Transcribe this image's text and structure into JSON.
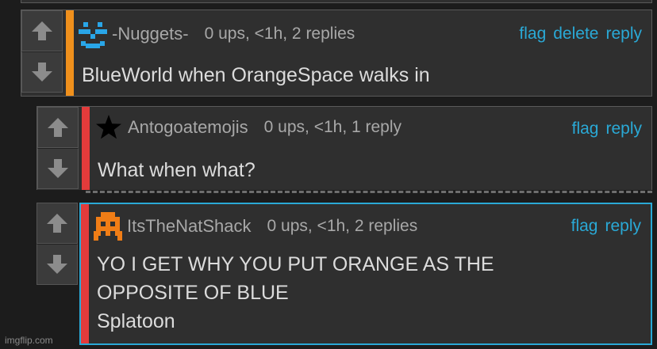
{
  "comments": [
    {
      "username": "-Nuggets-",
      "stats": "0 ups, <1h, 2 replies",
      "actions": [
        "flag",
        "delete",
        "reply"
      ],
      "body": "BlueWorld when OrangeSpace walks in",
      "accent_color": "#f0901c",
      "avatar_icon": "blue-pixel-face-icon"
    },
    {
      "username": "Antogoatemojis",
      "stats": "0 ups, <1h, 1 reply",
      "actions": [
        "flag",
        "reply"
      ],
      "body": "What when what?",
      "accent_color": "#e33b3b",
      "avatar_icon": "black-star-icon"
    },
    {
      "username": "ItsTheNatShack",
      "stats": "0 ups, <1h, 2 replies",
      "actions": [
        "flag",
        "reply"
      ],
      "body": "YO I GET WHY YOU PUT ORANGE AS THE\nOPPOSITE OF BLUE\nSplatoon",
      "accent_color": "#e33b3b",
      "avatar_icon": "orange-pixel-face-icon"
    }
  ],
  "watermark": "imgflip.com",
  "colors": {
    "link": "#2aa9d6",
    "highlight_border": "#2aa9d6",
    "panel": "#2f2f2f"
  }
}
